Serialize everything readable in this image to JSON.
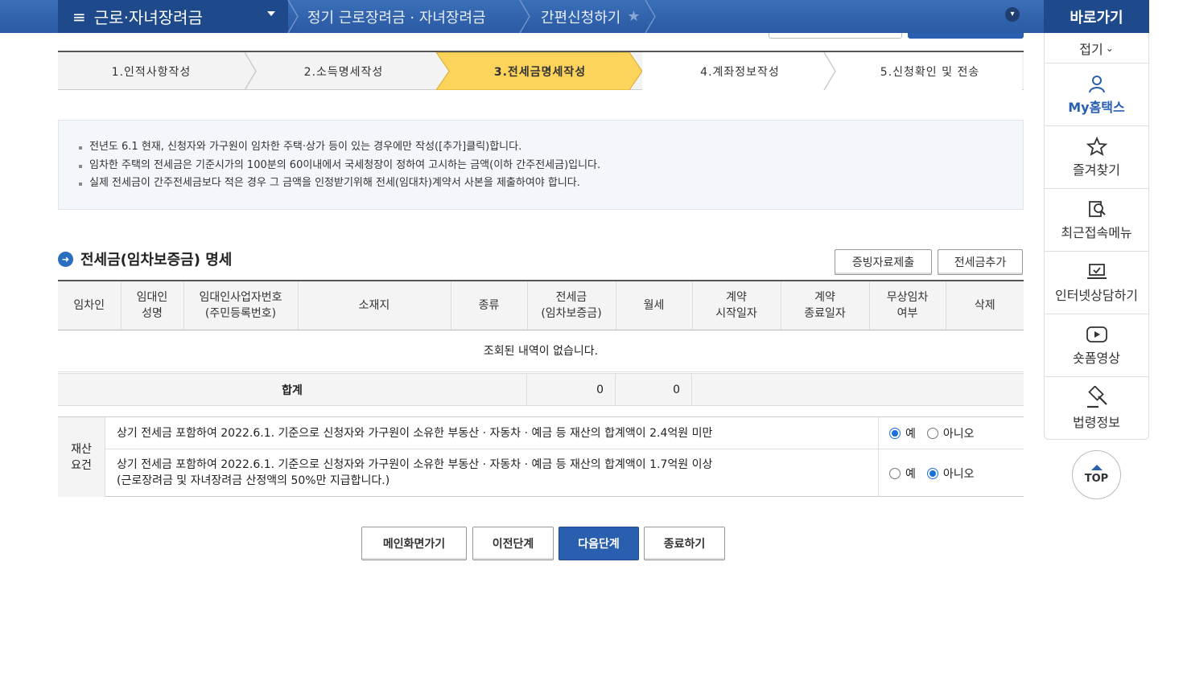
{
  "header": {
    "menu_title": "근로·자녀장려금",
    "breadcrumb_1": "정기 근로장려금 · 자녀장려금",
    "breadcrumb_2": "간편신청하기"
  },
  "sidebar": {
    "title": "바로가기",
    "fold": "접기",
    "items": [
      {
        "label": "My홈택스"
      },
      {
        "label": "즐겨찾기"
      },
      {
        "label": "최근접속메뉴"
      },
      {
        "label": "인터넷상담하기"
      },
      {
        "label": "숏폼영상"
      },
      {
        "label": "법령정보"
      }
    ],
    "top_label": "TOP"
  },
  "steps": [
    {
      "label": "1.인적사항작성"
    },
    {
      "label": "2.소득명세작성"
    },
    {
      "label": "3.전세금명세작성"
    },
    {
      "label": "4.계좌정보작성"
    },
    {
      "label": "5.신청확인 및 전송"
    }
  ],
  "notice": [
    "전년도 6.1 현재, 신청자와 가구원이 임차한 주택·상가 등이 있는 경우에만 작성([추가]클릭)합니다.",
    "임차한 주택의 전세금은 기준시가의 100분의 60이내에서 국세청장이 정하여 고시하는 금액(이하 간주전세금)입니다.",
    "실제 전세금이 간주전세금보다 적은 경우 그 금액을 인정받기위해 전세(임대차)계약서 사본을 제출하여야 합니다."
  ],
  "section": {
    "title": "전세금(임차보증금) 명세",
    "btn_evidence": "증빙자료제출",
    "btn_add": "전세금추가"
  },
  "table": {
    "headers": [
      "임차인",
      "임대인\n성명",
      "임대인사업자번호\n(주민등록번호)",
      "소재지",
      "종류",
      "전세금\n(임차보증금)",
      "월세",
      "계약\n시작일자",
      "계약\n종료일자",
      "무상임차\n여부",
      "삭제"
    ],
    "empty": "조회된 내역이 없습니다.",
    "sum_label": "합계",
    "sum_deposit": "0",
    "sum_monthly": "0"
  },
  "asset": {
    "head": "재산\n요건",
    "row1": "상기 전세금 포함하여 2022.6.1. 기준으로 신청자와 가구원이 소유한 부동산 · 자동차 · 예금 등 재산의 합계액이 2.4억원 미만",
    "row2_line1": "상기 전세금 포함하여 2022.6.1. 기준으로 신청자와 가구원이 소유한 부동산 · 자동차 · 예금 등 재산의 합계액이 1.7억원 이상",
    "row2_line2": "(근로장려금 및 자녀장려금 산정액의 50%만 지급합니다.)",
    "yes": "예",
    "no": "아니오"
  },
  "buttons": {
    "main": "메인화면가기",
    "prev": "이전단계",
    "next": "다음단계",
    "close": "종료하기"
  }
}
